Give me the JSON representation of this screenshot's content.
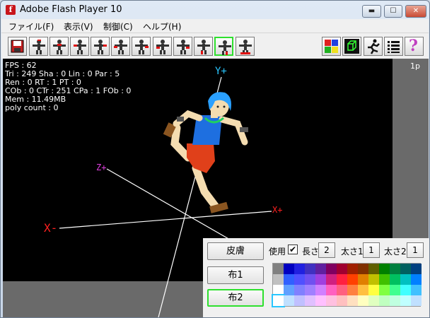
{
  "window": {
    "title": "Adobe Flash Player 10",
    "icon": "flash-icon",
    "controls": [
      "minimize-icon",
      "maximize-icon",
      "close-icon"
    ]
  },
  "menu": [
    "ファイル(F)",
    "表示(V)",
    "制御(C)",
    "ヘルプ(H)"
  ],
  "toolbar": {
    "left_buttons": [
      "save-icon",
      "pose-1",
      "pose-2",
      "pose-3",
      "pose-4",
      "pose-5",
      "pose-6",
      "pose-7",
      "pose-8",
      "pose-9",
      "pose-10",
      "pose-11"
    ],
    "active_index": 10,
    "right_buttons": [
      "color-grid-icon",
      "cube-icon",
      "running-man-icon",
      "list-icon",
      "help-icon"
    ],
    "help_label": "?"
  },
  "stats": [
    "FPS : 62",
    "Tri : 249 Sha : 0 Lin : 0 Par : 5",
    "Ren : 0 RT : 1 PT : 0",
    "COb : 0 CTr : 251 CPa : 1 FOb : 0",
    "Mem : 11.49MB",
    "poly count : 0"
  ],
  "page_label": "1p",
  "axes": {
    "y_plus": "Y+",
    "z_plus": "Z+",
    "x_plus": "X+",
    "x_minus": "X-"
  },
  "panel": {
    "buttons": [
      "皮膚",
      "布1",
      "布2"
    ],
    "active_button": 2,
    "use_label": "使用",
    "use_checked": true,
    "check_mark": "✔",
    "length_label": "長さ",
    "length_value": "2",
    "width1_label": "太さ1",
    "width1_value": "1",
    "width2_label": "太さ2",
    "width2_value": "1"
  },
  "palette": {
    "rows": [
      [
        "#808080",
        "#0000c0",
        "#2020e0",
        "#4030c0",
        "#6020a0",
        "#800060",
        "#a00030",
        "#a02000",
        "#803000",
        "#606000",
        "#008000",
        "#008040",
        "#006060",
        "#004080"
      ],
      [
        "#c0c0c0",
        "#3060ff",
        "#5050ff",
        "#7050f0",
        "#a040e0",
        "#d02080",
        "#ff2040",
        "#ff4000",
        "#e08000",
        "#c0c000",
        "#40c000",
        "#00c060",
        "#00c0c0",
        "#0080ff"
      ],
      [
        "#ffffff",
        "#60a0ff",
        "#8080ff",
        "#a080ff",
        "#d080ff",
        "#ff60c0",
        "#ff6080",
        "#ff8040",
        "#ffc040",
        "#ffff40",
        "#80ff40",
        "#40ff90",
        "#40ffff",
        "#40c0ff"
      ],
      [
        "#ffffff",
        "#c0e0ff",
        "#c0c0ff",
        "#e0c0ff",
        "#ffc0ff",
        "#ffc0e0",
        "#ffc0c0",
        "#ffe0c0",
        "#ffffc0",
        "#e0ffc0",
        "#c0ffc0",
        "#c0ffe0",
        "#c0ffff",
        "#c0e0ff"
      ]
    ],
    "selected": "#ffffff"
  },
  "colors": {
    "y_axis": "#29c6ff",
    "z_axis": "#e040e0",
    "x_plus": "#ff2020",
    "x_minus": "#ff2020",
    "stage_bg": "#000000",
    "side_panel": "#6a6a6a",
    "active_border": "#2ee02e"
  }
}
